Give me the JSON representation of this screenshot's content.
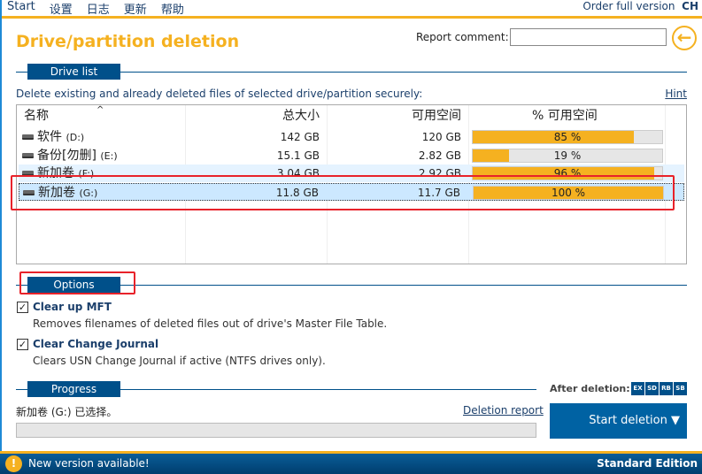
{
  "menu": [
    "Start",
    "设置",
    "日志",
    "更新",
    "帮助"
  ],
  "order_link": "Order full version",
  "lang": "CH",
  "title": "Drive/partition deletion",
  "report_comment_label": "Report comment:",
  "report_comment_value": "",
  "drive_list": {
    "header": "Drive list",
    "description": "Delete existing and already deleted files of selected drive/partition securely:",
    "hint": "Hint",
    "columns": [
      "名称",
      "总大小",
      "可用空间",
      "% 可用空间"
    ],
    "rows": [
      {
        "name": "软件",
        "letter": "(D:)",
        "size": "142 GB",
        "free": "120 GB",
        "pct_label": "85 %",
        "pct": 85
      },
      {
        "name": "备份[勿删]",
        "letter": "(E:)",
        "size": "15.1 GB",
        "free": "2.82 GB",
        "pct_label": "19 %",
        "pct": 19
      },
      {
        "name": "新加卷",
        "letter": "(F:)",
        "size": "3.04 GB",
        "free": "2.92 GB",
        "pct_label": "96 %",
        "pct": 96
      },
      {
        "name": "新加卷",
        "letter": "(G:)",
        "size": "11.8 GB",
        "free": "11.7 GB",
        "pct_label": "100 %",
        "pct": 100
      }
    ]
  },
  "options": {
    "header": "Options",
    "items": [
      {
        "label": "Clear up MFT",
        "desc": "Removes filenames of deleted files out of drive's Master File Table."
      },
      {
        "label": "Clear Change Journal",
        "desc": "Clears USN Change Journal if active (NTFS drives only)."
      }
    ]
  },
  "progress": {
    "header": "Progress",
    "status": "新加卷 (G:) 已选择。",
    "report_link": "Deletion report",
    "value": 0
  },
  "after_deletion": {
    "label": "After deletion:",
    "badges": [
      "EX",
      "SD",
      "RB",
      "SB"
    ]
  },
  "start_button": "Start deletion",
  "status": {
    "message": "New version available!",
    "edition": "Standard Edition"
  }
}
